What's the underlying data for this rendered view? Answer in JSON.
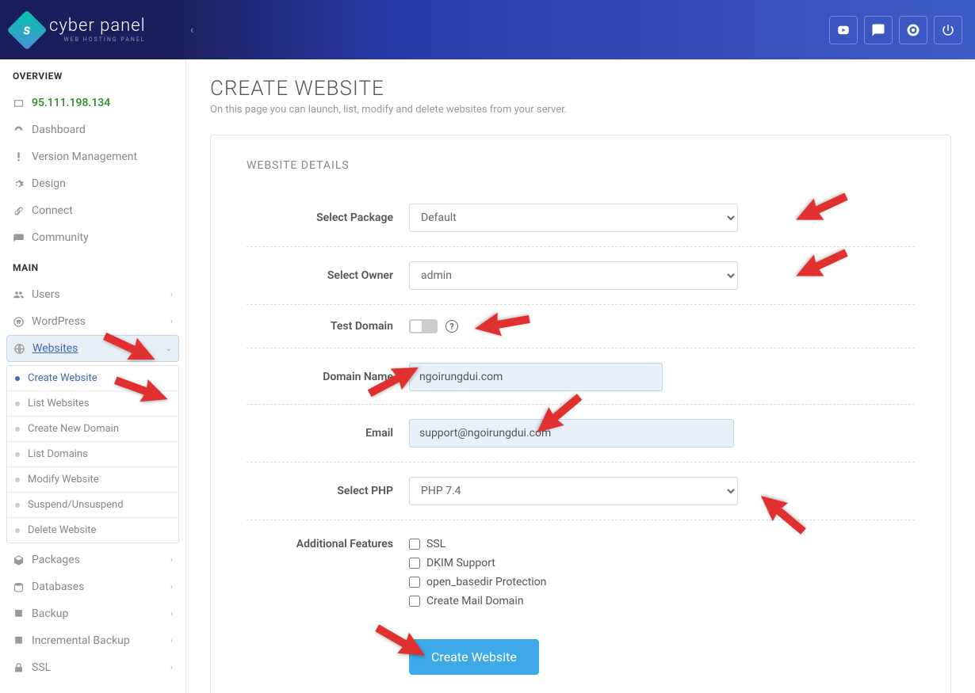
{
  "brand": {
    "name": "cyber panel",
    "tagline": "WEB HOSTING PANEL"
  },
  "sidebar": {
    "overview_title": "OVERVIEW",
    "ip": "95.111.198.134",
    "overview_items": [
      {
        "label": "Dashboard",
        "icon": "dashboard"
      },
      {
        "label": "Version Management",
        "icon": "info"
      },
      {
        "label": "Design",
        "icon": "gear"
      },
      {
        "label": "Connect",
        "icon": "link"
      },
      {
        "label": "Community",
        "icon": "chat"
      }
    ],
    "main_title": "MAIN",
    "main_items": [
      {
        "label": "Users",
        "icon": "users",
        "chevron": "›"
      },
      {
        "label": "WordPress",
        "icon": "wordpress",
        "chevron": "›"
      },
      {
        "label": "Websites",
        "icon": "globe",
        "chevron": "⌄",
        "active": true
      },
      {
        "label": "Packages",
        "icon": "box",
        "chevron": "›"
      },
      {
        "label": "Databases",
        "icon": "db",
        "chevron": "›"
      },
      {
        "label": "Backup",
        "icon": "floppy",
        "chevron": "›"
      },
      {
        "label": "Incremental Backup",
        "icon": "floppy",
        "chevron": "›"
      },
      {
        "label": "SSL",
        "icon": "lock",
        "chevron": "›"
      }
    ],
    "websites_sub": [
      {
        "label": "Create Website",
        "active": true
      },
      {
        "label": "List Websites"
      },
      {
        "label": "Create New Domain"
      },
      {
        "label": "List Domains"
      },
      {
        "label": "Modify Website"
      },
      {
        "label": "Suspend/Unsuspend"
      },
      {
        "label": "Delete Website"
      }
    ]
  },
  "page": {
    "title": "CREATE WEBSITE",
    "desc": "On this page you can launch, list, modify and delete websites from your server.",
    "panel_title": "WEBSITE DETAILS",
    "labels": {
      "package": "Select Package",
      "owner": "Select Owner",
      "test_domain": "Test Domain",
      "domain": "Domain Name",
      "email": "Email",
      "php": "Select PHP",
      "features": "Additional Features"
    },
    "values": {
      "package": "Default",
      "owner": "admin",
      "domain": "ngoirungdui.com",
      "email": "support@ngoirungdui.com",
      "php": "PHP 7.4"
    },
    "features": [
      "SSL",
      "DKIM Support",
      "open_basedir Protection",
      "Create Mail Domain"
    ],
    "submit": "Create Website",
    "help": "?"
  }
}
